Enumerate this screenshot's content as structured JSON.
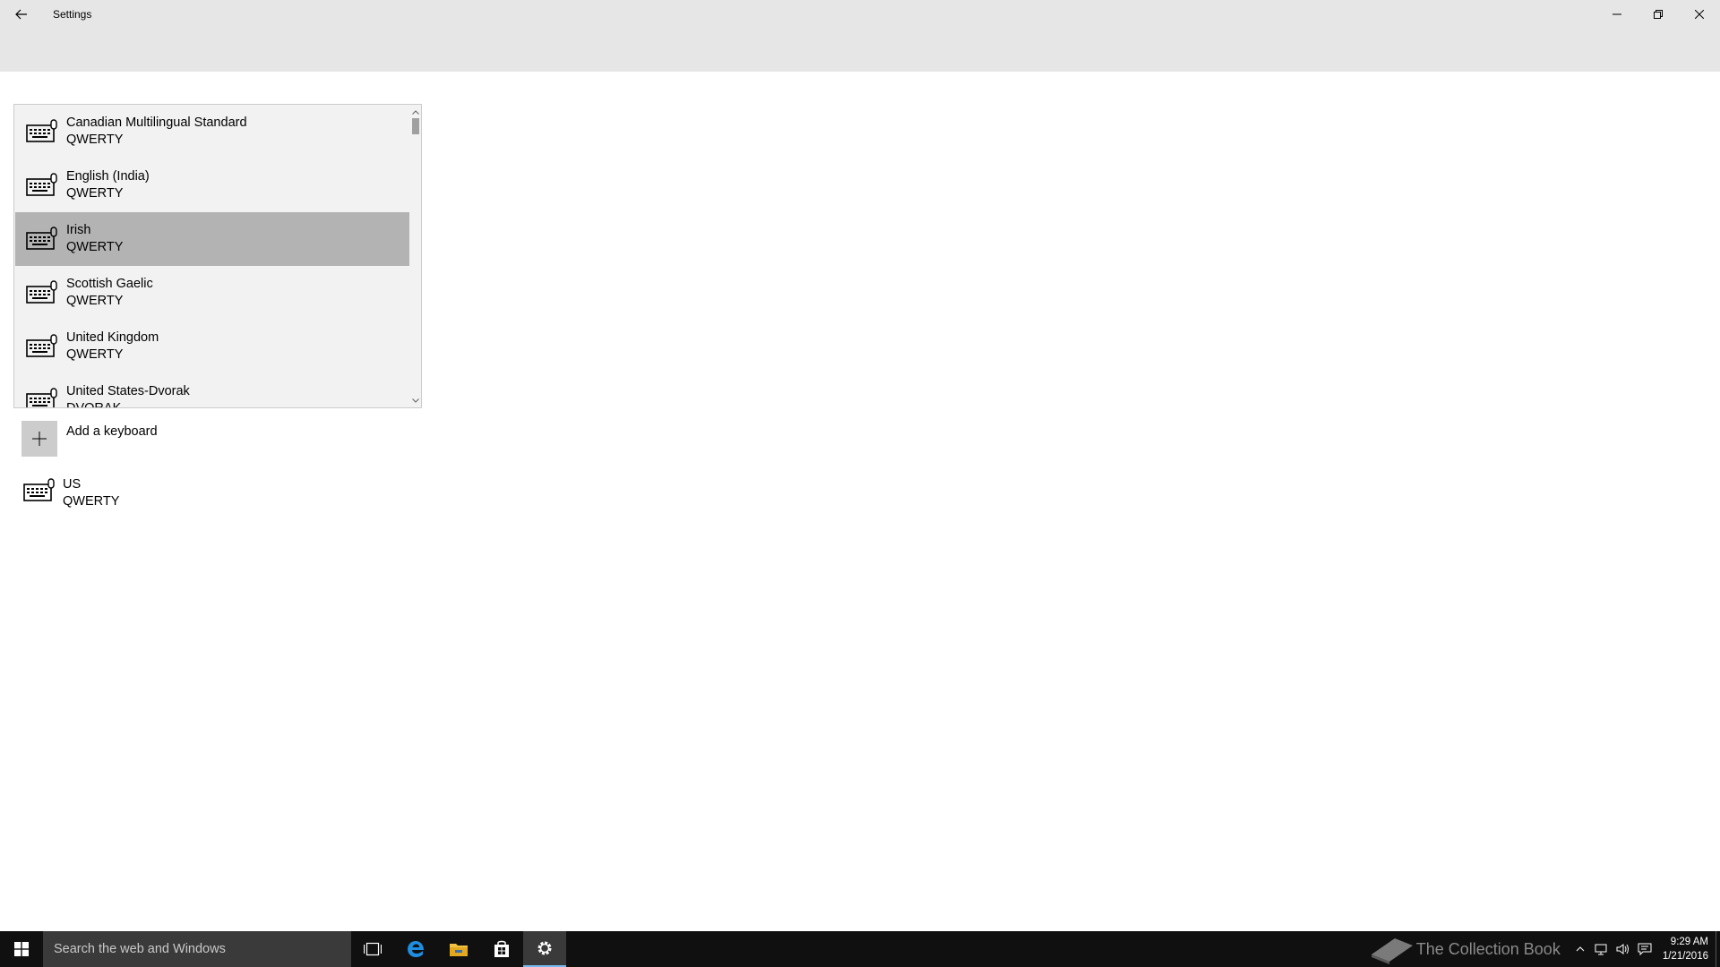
{
  "window": {
    "title": "Settings"
  },
  "dropdown": {
    "items": [
      {
        "name": "Canadian Multilingual Standard",
        "layout": "QWERTY"
      },
      {
        "name": "English (India)",
        "layout": "QWERTY"
      },
      {
        "name": "Irish",
        "layout": "QWERTY"
      },
      {
        "name": "Scottish Gaelic",
        "layout": "QWERTY"
      },
      {
        "name": "United Kingdom",
        "layout": "QWERTY"
      },
      {
        "name": "United States-Dvorak",
        "layout": "DVORAK"
      }
    ],
    "selected_index": 2
  },
  "add_keyboard": {
    "label": "Add a keyboard"
  },
  "installed_keyboard": {
    "name": "US",
    "layout": "QWERTY"
  },
  "taskbar": {
    "search_placeholder": "Search the web and Windows",
    "watermark": "The Collection Book",
    "time": "9:29 AM",
    "date": "1/21/2016"
  },
  "colors": {
    "chrome": "#e6e6e6",
    "selected_item": "#b3b3b3",
    "taskbar": "#101010",
    "accent": "#76b9ed"
  }
}
